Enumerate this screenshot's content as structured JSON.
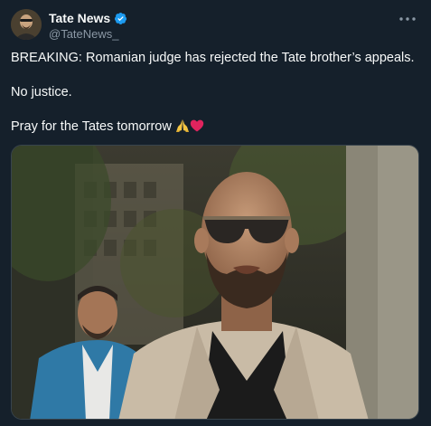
{
  "account": {
    "display_name": "Tate News",
    "handle": "@TateNews_",
    "avatar_icon": "profile-photo",
    "verified_icon": "verified-badge-icon"
  },
  "tweet": {
    "paragraphs": [
      "BREAKING: Romanian judge has rejected the Tate brother’s appeals.",
      "No justice.",
      "Pray for the Tates tomorrow"
    ],
    "emojis": [
      "praying-hands-icon",
      "red-heart-icon"
    ]
  },
  "media": {
    "type": "photo"
  },
  "colors": {
    "background": "#15202b",
    "text": "#f7f9f9",
    "secondary_text": "#8b98a5",
    "verified": "#1d9bf0",
    "border": "#38444d"
  }
}
